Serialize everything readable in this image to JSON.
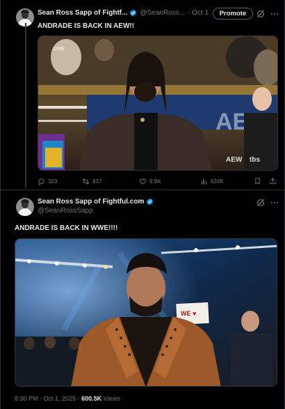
{
  "tweet1": {
    "author_name": "Sean Ross Sapp of Fightf...",
    "author_handle": "@SeanRoss...",
    "date": "· Oct 1",
    "promote_label": "Promote",
    "text": "ANDRADE IS BACK IN AEW!!",
    "image_description_signs": [
      "LIVE",
      "AEW",
      "tbs"
    ],
    "stats": {
      "replies": "323",
      "reposts": "837",
      "likes": "9.9K",
      "views": "624K"
    }
  },
  "tweet2": {
    "author_name": "Sean Ross Sapp of Fightful.com",
    "author_handle": "@SeanRossSapp",
    "text": "ANDRADE IS BACK IN WWE!!!!",
    "time": "8:30 PM",
    "date": "· Oct 1, 2025 ·",
    "views_count": "600.5K",
    "views_label": "Views"
  },
  "colors": {
    "background": "#000000",
    "text_primary": "#e7e9ea",
    "text_secondary": "#71767b",
    "verified": "#1d9bf0",
    "border": "#2f3336"
  }
}
